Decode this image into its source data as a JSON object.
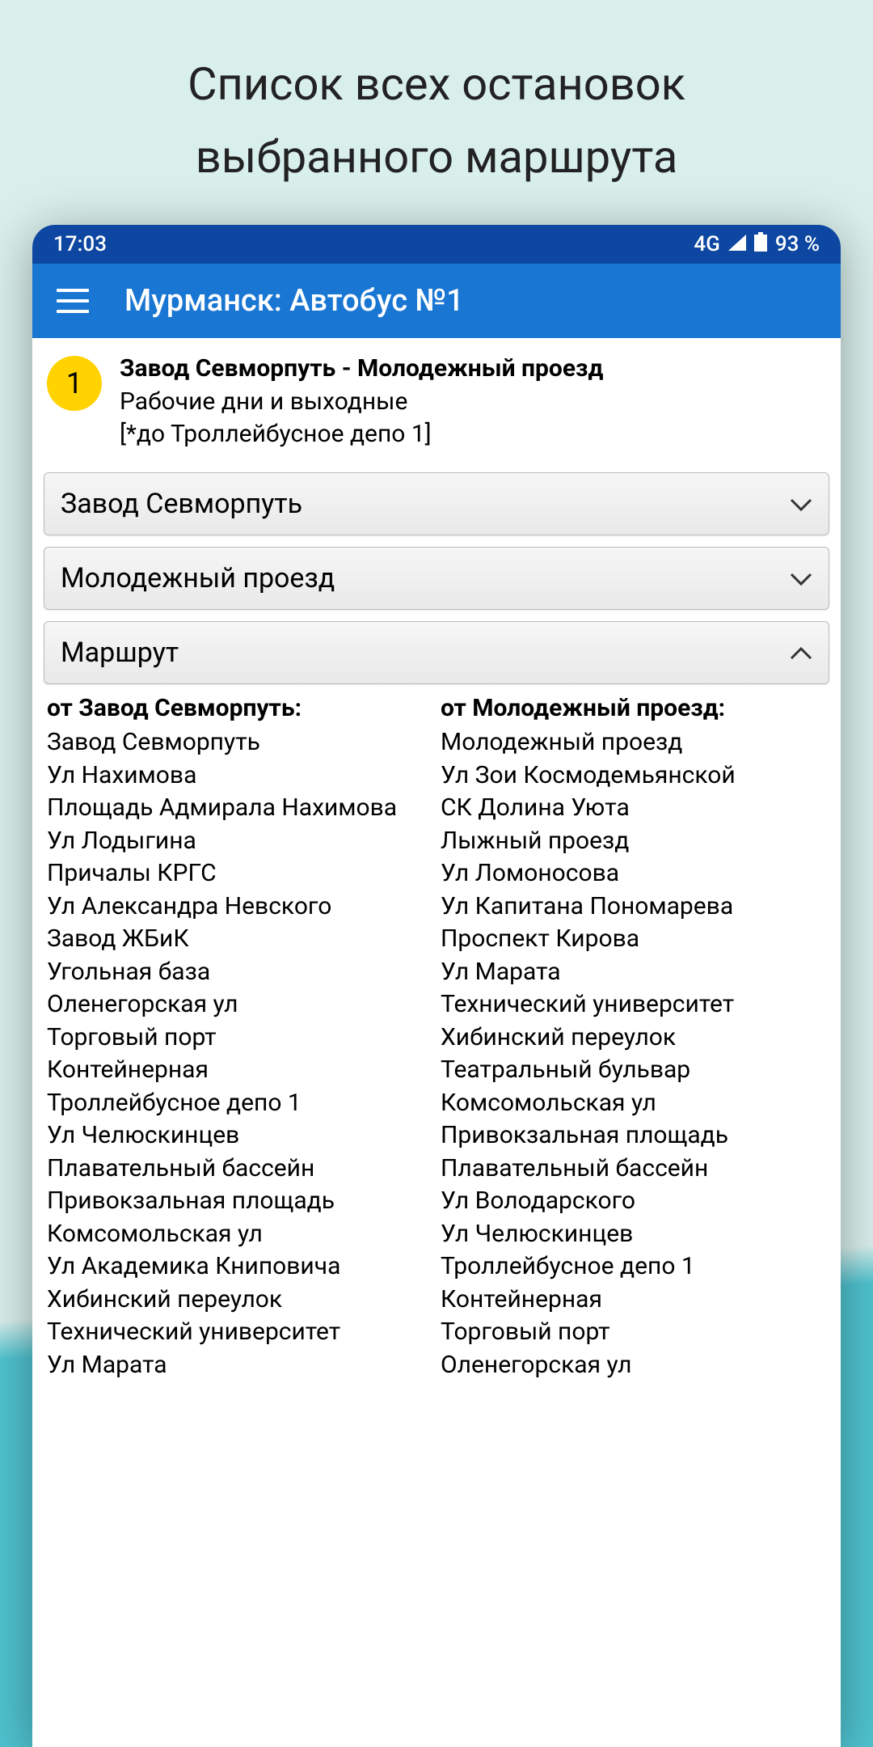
{
  "promo": {
    "title_line1": "Список всех остановок",
    "title_line2": "выбранного маршрута"
  },
  "statusbar": {
    "time": "17:03",
    "network": "4G",
    "battery": "93 %"
  },
  "appbar": {
    "title": "Мурманск: Автобус №1"
  },
  "route": {
    "badge": "1",
    "name": "Завод Севморпуть - Молодежный проезд",
    "schedule": "Рабочие дни и выходные",
    "note": "[*до Троллейбусное депо 1]"
  },
  "panels": {
    "from": "Завод Севморпуть",
    "to": "Молодежный проезд",
    "route_label": "Маршрут"
  },
  "stops": {
    "left_header": "от Завод Севморпуть:",
    "left": [
      "Завод Севморпуть",
      "Ул Нахимова",
      "Площадь Адмирала Нахимова",
      "Ул Лодыгина",
      "Причалы КРГС",
      "Ул Александра Невского",
      "Завод ЖБиК",
      "Угольная база",
      "Оленегорская ул",
      "Торговый порт",
      "Контейнерная",
      "Троллейбусное депо 1",
      "Ул Челюскинцев",
      "Плавательный бассейн",
      "Привокзальная площадь",
      "Комсомольская ул",
      "Ул Академика Книповича",
      "Хибинский переулок",
      "Технический университет",
      "Ул Марата"
    ],
    "right_header": "от Молодежный проезд:",
    "right": [
      "Молодежный проезд",
      "Ул Зои Космодемьянской",
      "СК Долина Уюта",
      "Лыжный проезд",
      "Ул Ломоносова",
      "Ул Капитана Пономарева",
      "Проспект Кирова",
      "Ул Марата",
      "Технический университет",
      "Хибинский переулок",
      "Театральный бульвар",
      "Комсомольская ул",
      "Привокзальная площадь",
      "Плавательный бассейн",
      "Ул Володарского",
      "Ул Челюскинцев",
      "Троллейбусное депо 1",
      "Контейнерная",
      "Торговый порт",
      "Оленегорская ул"
    ]
  }
}
